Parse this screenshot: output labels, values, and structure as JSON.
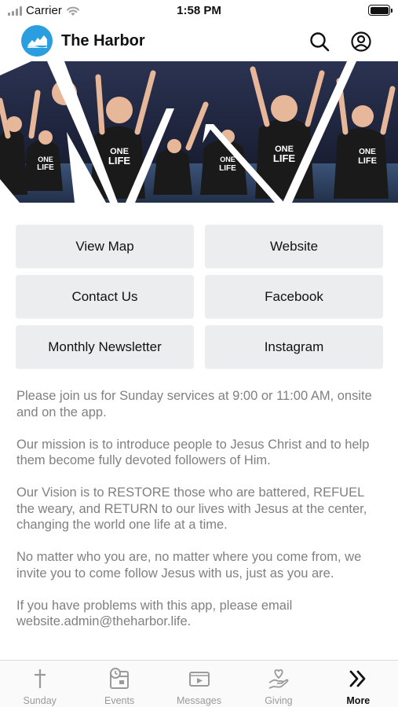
{
  "status_bar": {
    "carrier": "Carrier",
    "time": "1:58 PM"
  },
  "header": {
    "title": "The Harbor"
  },
  "hero": {
    "shirt_text": "ONE LIFE AT A TIME"
  },
  "buttons": {
    "view_map": "View Map",
    "website": "Website",
    "contact_us": "Contact Us",
    "facebook": "Facebook",
    "newsletter": "Monthly Newsletter",
    "instagram": "Instagram"
  },
  "content": {
    "p1": "Please join us for Sunday services at 9:00 or 11:00 AM, onsite and on the app.",
    "p2": "Our mission is to introduce people to Jesus Christ and to help them become fully devoted followers of Him.",
    "p3": "Our Vision is to RESTORE those who are battered, REFUEL the weary, and RETURN to our lives with Jesus at the center, changing the world one life at a time.",
    "p4": "No matter who you are, no matter where you come from, we invite you to come follow Jesus with us, just as you are.",
    "p5": "If you have problems with this app, please email website.admin@theharbor.life."
  },
  "tabs": [
    {
      "label": "Sunday",
      "icon": "cross-icon"
    },
    {
      "label": "Events",
      "icon": "calendar-clock-icon"
    },
    {
      "label": "Messages",
      "icon": "video-play-icon"
    },
    {
      "label": "Giving",
      "icon": "hand-heart-icon"
    },
    {
      "label": "More",
      "icon": "double-chevron-right-icon",
      "active": true
    }
  ],
  "colors": {
    "brand": "#2a9ede",
    "button_bg": "#ecedef",
    "body_text": "#808080",
    "tab_inactive": "#9a9a9a"
  }
}
